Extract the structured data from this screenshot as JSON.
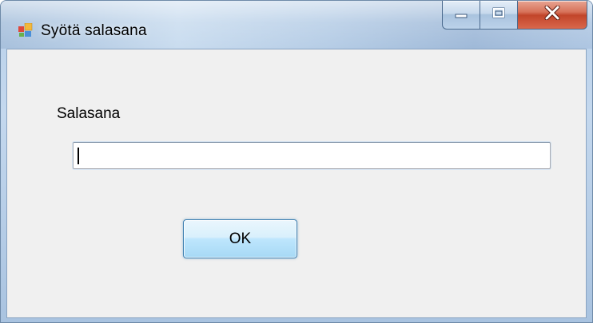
{
  "window": {
    "title": "Syötä salasana",
    "icon": "application-icon",
    "caption_buttons": {
      "minimize_icon": "minimize-icon",
      "maximize_icon": "maximize-icon",
      "close_icon": "close-icon"
    }
  },
  "form": {
    "password_label": "Salasana",
    "password_value": "",
    "ok_label": "OK"
  },
  "colors": {
    "close_button": "#c2452a",
    "button_border": "#3c7fb1",
    "content_background": "#f0f0f0"
  }
}
